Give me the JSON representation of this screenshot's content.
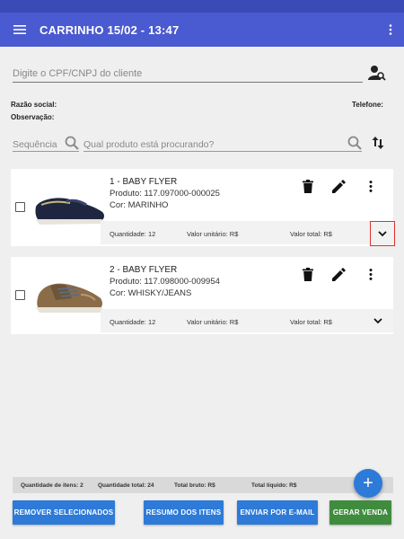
{
  "app": {
    "title": "CARRINHO 15/02 - 13:47",
    "menu_icon": "menu-icon",
    "more_icon": "more-vert-icon",
    "accent": "#4a5ad0"
  },
  "client": {
    "placeholder": "Digite o CPF/CNPJ do cliente",
    "search_icon": "person-search-icon"
  },
  "labels": {
    "razao_social": "Razão social:",
    "telefone": "Telefone:",
    "observacao": "Observação:"
  },
  "search": {
    "sequence_placeholder": "Sequência",
    "product_placeholder": "Qual produto está procurando?",
    "sort_icon": "swap-vert-icon"
  },
  "items": [
    {
      "title": "1 - BABY FLYER",
      "product": "Produto: 117.097000-000025",
      "color": "Cor: MARINHO",
      "quantity": "Quantidade: 12",
      "unit_value": "Valor unitário: R$",
      "total_value": "Valor total: R$",
      "image": "navy-loafer-shoe"
    },
    {
      "title": "2 - BABY FLYER",
      "product": "Produto: 117.098000-009954",
      "color": "Cor: WHISKY/JEANS",
      "quantity": "Quantidade: 12",
      "unit_value": "Valor unitário: R$",
      "total_value": "Valor total: R$",
      "image": "brown-sneaker-shoe"
    }
  ],
  "totals": {
    "items": "Quantidade de itens: 2",
    "quantity": "Quantidade total: 24",
    "gross": "Total bruto: R$",
    "net": "Total líquido: R$"
  },
  "fab_label": "+",
  "buttons": {
    "remove": "REMOVER SELECIONADOS",
    "summary": "RESUMO DOS ITENS",
    "email": "ENVIAR POR E-MAIL",
    "generate": "GERAR VENDA"
  },
  "colors": {
    "primary_button": "#2d7ad8",
    "generate_button": "#3f8c3f",
    "highlight_border": "#e03030"
  }
}
